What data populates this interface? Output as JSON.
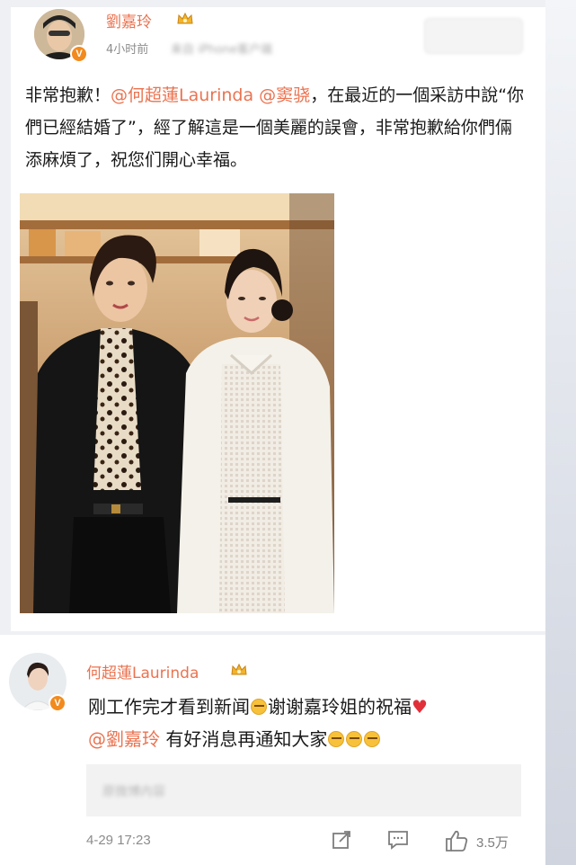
{
  "post": {
    "author": "劉嘉玲",
    "time": "4小时前",
    "source_blurred": "来自 iPhone客户端",
    "text_pre": "非常抱歉！",
    "mention1": "@何超蓮Laurinda",
    "mention2": "@窦骁",
    "text_post": "，在最近的一個采訪中說“你們已經結婚了”，經了解這是一個美麗的誤會，非常抱歉給你們倆添麻煩了，祝您们開心幸福。"
  },
  "reply": {
    "author": "何超蓮Laurinda",
    "text1": "刚工作完才看到新闻",
    "text2": "谢谢嘉玲姐的祝福",
    "mention": "@劉嘉玲",
    "text3": " 有好消息再通知大家",
    "quote_blurred": "原微博内容",
    "time": "4-29 17:23",
    "likes": "3.5万"
  },
  "colors": {
    "accent": "#eb7350",
    "verified": "#f28a1e",
    "text": "#1a1a1a",
    "meta": "#8c8c8c"
  },
  "icons": [
    "crown-icon",
    "verified-icon",
    "share-icon",
    "comment-icon",
    "like-icon",
    "cry-laugh-emoji",
    "heart-emoji",
    "sweat-emoji"
  ]
}
